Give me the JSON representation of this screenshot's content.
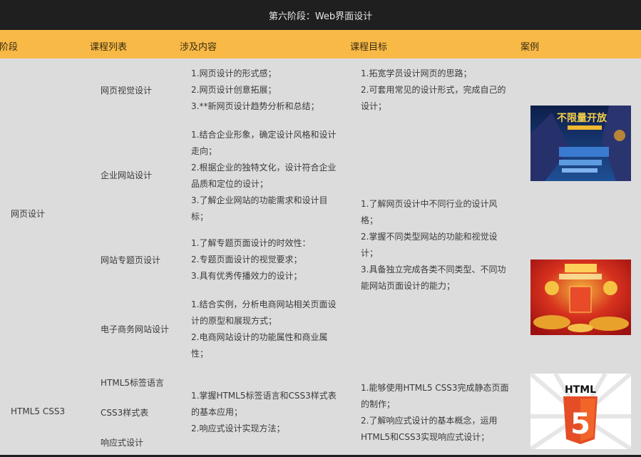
{
  "header": {
    "title": "第六阶段：Web界面设计"
  },
  "columns": {
    "stage": "阶段",
    "courses": "课程列表",
    "content": "涉及内容",
    "goals": "课程目标",
    "cases": "案例"
  },
  "stages": {
    "web_design": "网页设计",
    "html5_css3": "HTML5 CSS3"
  },
  "courses": {
    "visual": "网页视觉设计",
    "enterprise": "企业网站设计",
    "topic": "网站专题页设计",
    "ecommerce": "电子商务网站设计",
    "html5_tags": "HTML5标签语言",
    "css3": "CSS3样式表",
    "responsive": "响应式设计"
  },
  "content": {
    "visual": [
      "1.网页设计的形式感；",
      "2.网页设计创意拓展；",
      "3.**新网页设计趋势分析和总结；"
    ],
    "enterprise": [
      "1.结合企业形象，确定设计风格和设计",
      "走向；",
      "2.根据企业的独特文化，设计符合企业",
      "品质和定位的设计；",
      "3.了解企业网站的功能需求和设计目",
      "标；"
    ],
    "topic": [
      "1.了解专题页面设计的时效性：",
      "2.专题页面设计的视觉要求；",
      "3.具有优秀传播效力的设计；"
    ],
    "ecommerce": [
      "1.结合实例，分析电商网站相关页面设",
      "计的原型和展现方式；",
      "2.电商网站设计的功能属性和商业属",
      "性；"
    ],
    "html5": [
      "1.掌握HTML5标签语言和CSS3样式表",
      "的基本应用；",
      "2.响应式设计实现方法；"
    ]
  },
  "goals": {
    "group1": [
      "1.拓宽学员设计网页的思路；",
      "2.可套用常见的设计形式，完成自己的",
      "设计；"
    ],
    "group2": [
      "1.了解网页设计中不同行业的设计风",
      "格；",
      "2.掌握不同类型网站的功能和视觉设",
      "计；",
      "3.具备独立完成各类不同类型、不同功",
      "能网站页面设计的能力；"
    ],
    "group3": [
      "1.能够使用HTML5 CSS3完成静态页面",
      "的制作；",
      "2.了解响应式设计的基本概念，运用",
      "HTML5和CSS3实现响应式设计；"
    ]
  },
  "cases": {
    "game_banner_text": "不限量开放",
    "html5_logo_text": "HTML",
    "html5_logo_number": "5"
  },
  "colors": {
    "titlebar": "#1f1f1f",
    "header_row": "#f8b947",
    "body_bg": "#dcdcdc",
    "html5_orange": "#e44d26"
  }
}
